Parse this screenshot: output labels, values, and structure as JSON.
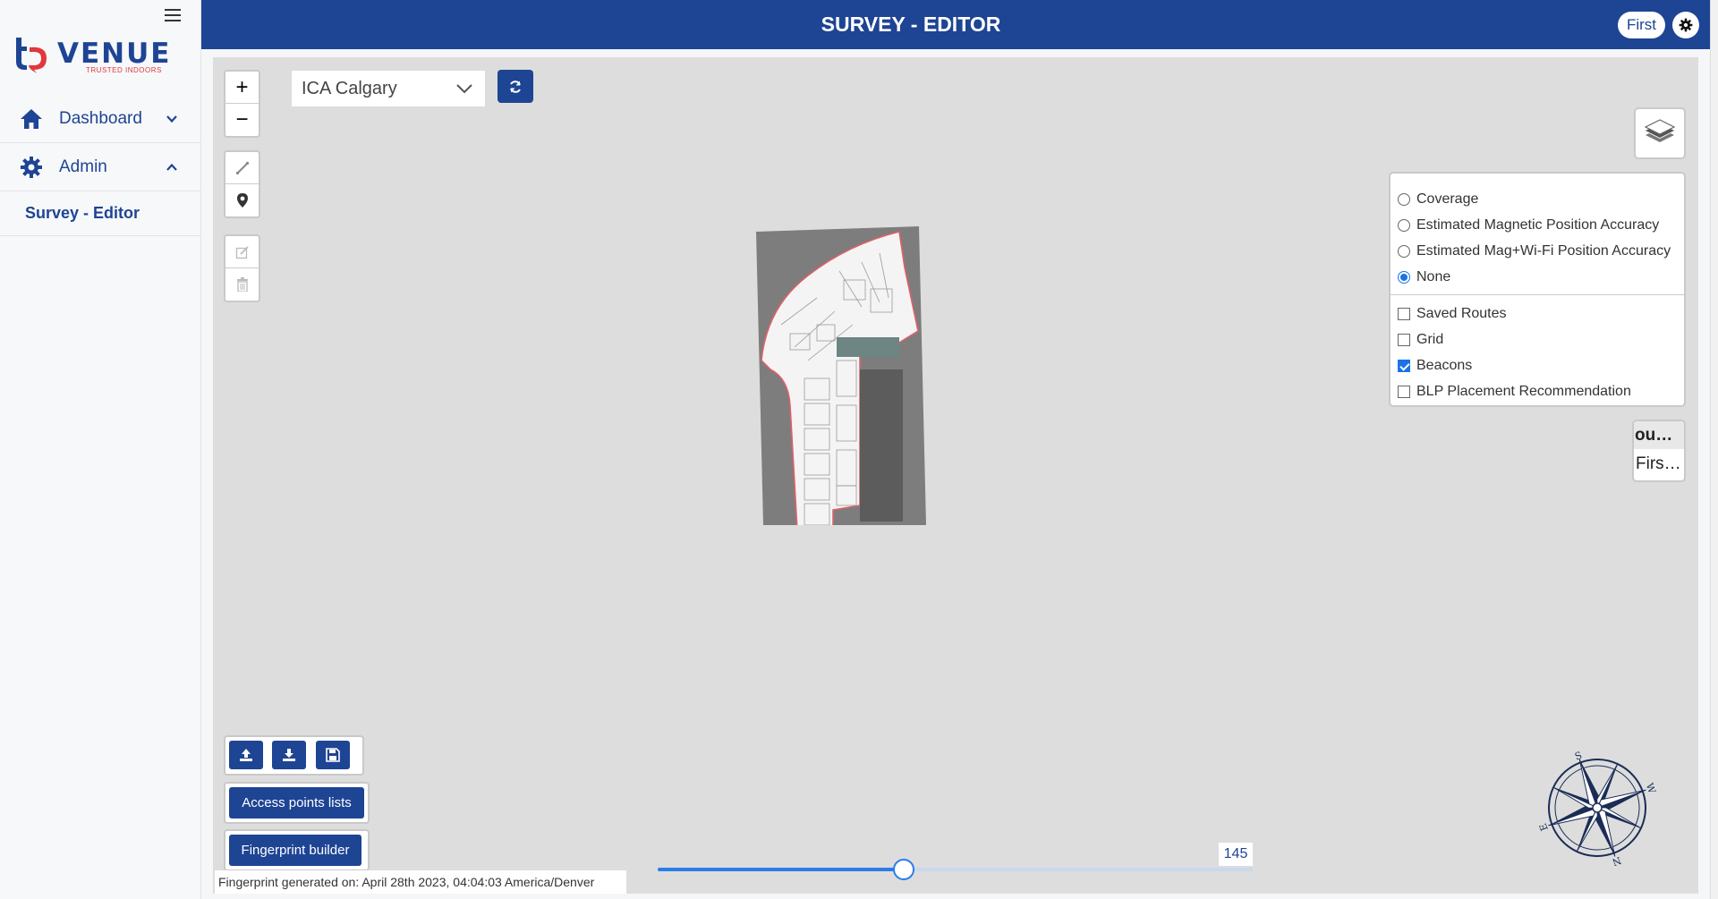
{
  "brand": {
    "name": "VENUE",
    "tagline": "TRUSTED INDOORS"
  },
  "sidebar": {
    "items": [
      {
        "label": "Dashboard",
        "icon": "home-icon",
        "expanded": false
      },
      {
        "label": "Admin",
        "icon": "gear-icon",
        "expanded": true
      }
    ],
    "sub_items": [
      {
        "label": "Survey - Editor"
      }
    ]
  },
  "header": {
    "title": "SURVEY - EDITOR",
    "user": "First"
  },
  "toolbar": {
    "site_select_value": "ICA Calgary",
    "zoom_in": "+",
    "zoom_out": "−"
  },
  "layers": {
    "radios": [
      {
        "label": "Coverage",
        "selected": false
      },
      {
        "label": "Estimated Magnetic Position Accuracy",
        "selected": false
      },
      {
        "label": "Estimated Mag+Wi-Fi Position Accuracy",
        "selected": false
      },
      {
        "label": "None",
        "selected": true
      }
    ],
    "checkboxes": [
      {
        "label": "Saved Routes",
        "checked": false
      },
      {
        "label": "Grid",
        "checked": false
      },
      {
        "label": "Beacons",
        "checked": true
      },
      {
        "label": "BLP Placement Recommendation",
        "checked": false
      }
    ]
  },
  "floors": {
    "group_label": "ou…",
    "selected": "First…"
  },
  "actions": {
    "access_points": "Access points lists",
    "fingerprint_builder": "Fingerprint builder"
  },
  "fingerprint_note": "Fingerprint generated on: April 28th 2023, 04:04:03 America/Denver",
  "slider": {
    "value": 145,
    "fill_fraction": 0.413
  },
  "compass": {
    "letters": [
      "S",
      "W",
      "N",
      "E"
    ]
  },
  "colors": {
    "brand_blue": "#1e4494",
    "accent_red": "#e0383e",
    "slider_blue": "#2b7de9"
  }
}
